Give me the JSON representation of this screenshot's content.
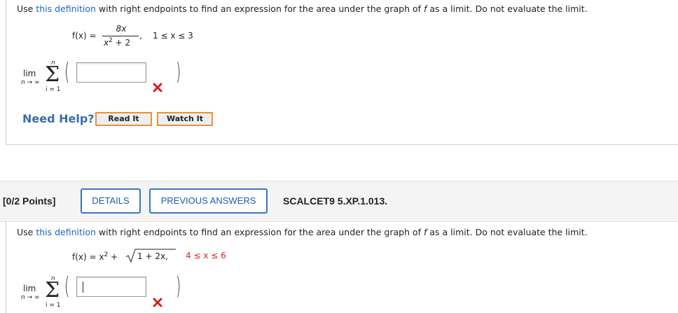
{
  "question1": {
    "instr_prefix": "Use ",
    "instr_link": "this definition",
    "instr_mid": " with right endpoints to find an expression for the area under the graph of ",
    "instr_f": "f",
    "instr_suffix": " as a limit. Do not evaluate the limit.",
    "func_lhs": "f(x) =",
    "numerator": "8x",
    "denominator": "x",
    "den_exp": "2",
    "den_rest": "+ 2",
    "comma": ",",
    "domain": "1 ≤ x ≤ 3",
    "lim": "lim",
    "lim_sub": "n → ∞",
    "sum_top": "n",
    "sum_bottom": "i = 1",
    "sigma": "Σ",
    "answer_value": "",
    "status": "incorrect"
  },
  "help": {
    "label": "Need Help?",
    "read": "Read It",
    "watch": "Watch It"
  },
  "question2": {
    "points": "[0/2 Points]",
    "details": "DETAILS",
    "previous": "PREVIOUS ANSWERS",
    "code": "SCALCET9 5.XP.1.013.",
    "instr_prefix": "Use ",
    "instr_link": "this definition",
    "instr_mid": " with right endpoints to find an expression for the area under the graph of ",
    "instr_f": "f",
    "instr_suffix": " as a limit. Do not evaluate the limit.",
    "func_lhs": "f(x) = x",
    "func_exp": "2",
    "func_plus": "+",
    "radicand": "1 + 2x,",
    "domain": "4 ≤ x ≤ 6",
    "lim": "lim",
    "lim_sub": "n → ∞",
    "sum_top": "n",
    "sum_bottom": "i = 1",
    "sigma": "Σ",
    "answer_value": "",
    "status": "incorrect"
  },
  "colors": {
    "link": "#1a64c8",
    "error": "#d22222",
    "button_border": "#3a75c4",
    "help_border": "#e8923a"
  }
}
